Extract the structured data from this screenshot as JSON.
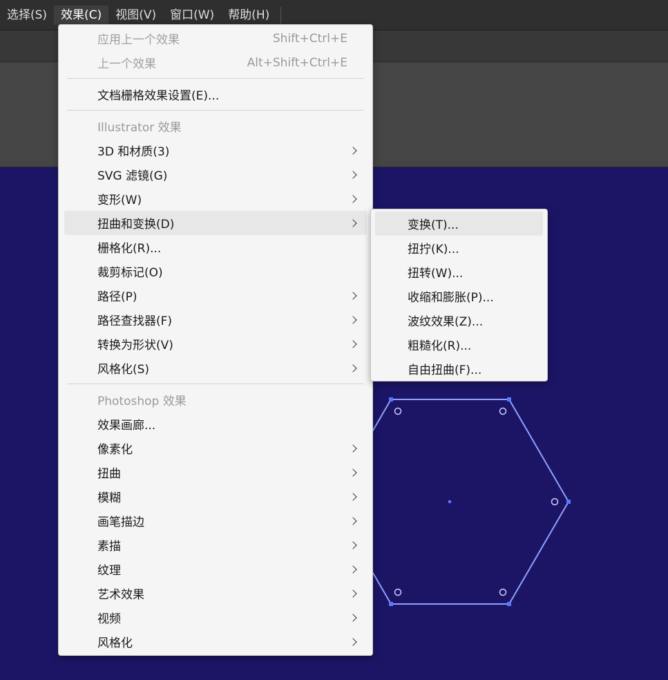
{
  "menubar": {
    "items": [
      "选择(S)",
      "效果(C)",
      "视图(V)",
      "窗口(W)",
      "帮助(H)"
    ]
  },
  "effect_menu": {
    "apply_last": {
      "label": "应用上一个效果",
      "shortcut": "Shift+Ctrl+E"
    },
    "last_effect": {
      "label": "上一个效果",
      "shortcut": "Alt+Shift+Ctrl+E"
    },
    "doc_raster": "文档栅格效果设置(E)...",
    "illustrator_header": "Illustrator 效果",
    "illustrator_items": [
      {
        "label": "3D 和材质(3)",
        "arrow": true
      },
      {
        "label": "SVG 滤镜(G)",
        "arrow": true
      },
      {
        "label": "变形(W)",
        "arrow": true
      },
      {
        "label": "扭曲和变换(D)",
        "arrow": true
      },
      {
        "label": "栅格化(R)...",
        "arrow": false
      },
      {
        "label": "裁剪标记(O)",
        "arrow": false
      },
      {
        "label": "路径(P)",
        "arrow": true
      },
      {
        "label": "路径查找器(F)",
        "arrow": true
      },
      {
        "label": "转换为形状(V)",
        "arrow": true
      },
      {
        "label": "风格化(S)",
        "arrow": true
      }
    ],
    "photoshop_header": "Photoshop 效果",
    "photoshop_items": [
      {
        "label": "效果画廊...",
        "arrow": false
      },
      {
        "label": "像素化",
        "arrow": true
      },
      {
        "label": "扭曲",
        "arrow": true
      },
      {
        "label": "模糊",
        "arrow": true
      },
      {
        "label": "画笔描边",
        "arrow": true
      },
      {
        "label": "素描",
        "arrow": true
      },
      {
        "label": "纹理",
        "arrow": true
      },
      {
        "label": "艺术效果",
        "arrow": true
      },
      {
        "label": "视频",
        "arrow": true
      },
      {
        "label": "风格化",
        "arrow": true
      }
    ]
  },
  "submenu": {
    "items": [
      "变换(T)...",
      "扭拧(K)...",
      "扭转(W)...",
      "收缩和膨胀(P)...",
      "波纹效果(Z)...",
      "粗糙化(R)...",
      "自由扭曲(F)..."
    ]
  },
  "colors": {
    "canvas": "#1c1566",
    "selection": "#5a78ff",
    "hex_stroke": "#8fa2ff"
  }
}
